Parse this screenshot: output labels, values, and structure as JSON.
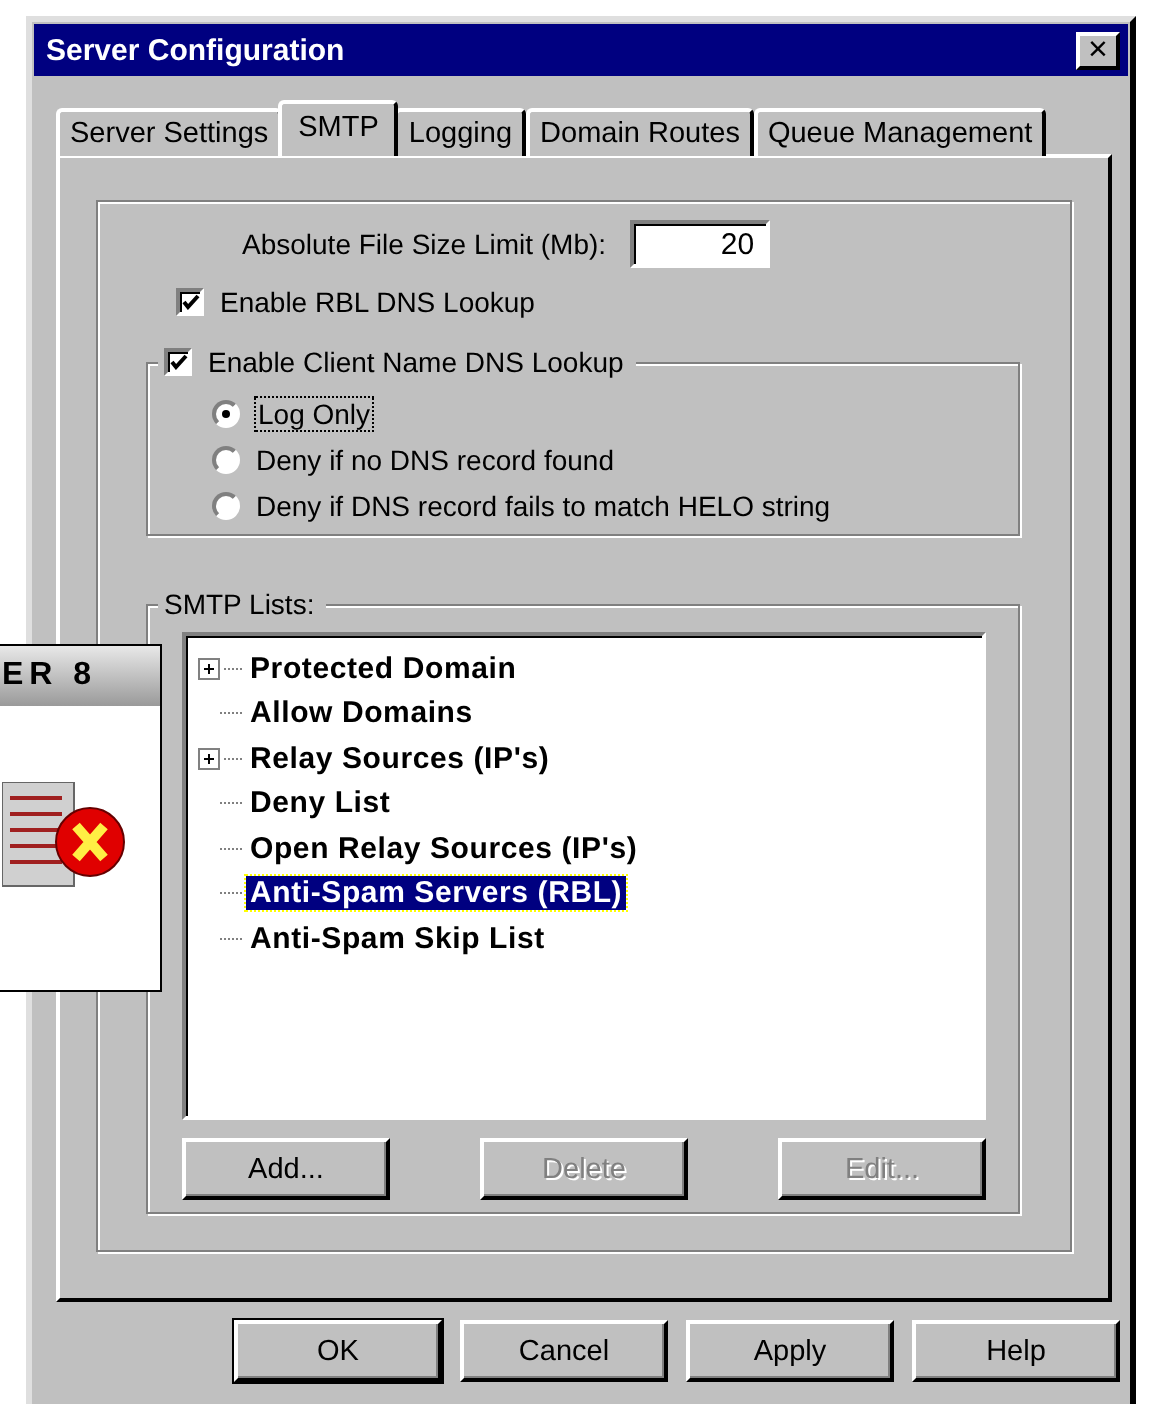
{
  "window": {
    "title": "Server Configuration",
    "close": "×"
  },
  "tabs": [
    {
      "label": "Server Settings",
      "selected": false
    },
    {
      "label": "SMTP",
      "selected": true
    },
    {
      "label": "Logging",
      "selected": false
    },
    {
      "label": "Domain Routes",
      "selected": false
    },
    {
      "label": "Queue Management",
      "selected": false
    }
  ],
  "file_size": {
    "label": "Absolute File Size Limit (Mb):",
    "value": "20"
  },
  "rbl_checkbox": {
    "label": "Enable RBL DNS Lookup",
    "checked": true
  },
  "client_name_group": {
    "label": "Enable Client Name DNS Lookup",
    "checked": true,
    "options": [
      {
        "label": "Log Only",
        "selected": true,
        "focused": true
      },
      {
        "label": "Deny if no DNS record found",
        "selected": false,
        "focused": false
      },
      {
        "label": "Deny if DNS record fails to match HELO string",
        "selected": false,
        "focused": false
      }
    ]
  },
  "smtp_lists": {
    "label": "SMTP Lists:",
    "items": [
      {
        "label": "Protected Domain",
        "expandable": true,
        "selected": false
      },
      {
        "label": "Allow Domains",
        "expandable": false,
        "selected": false
      },
      {
        "label": "Relay Sources (IP's)",
        "expandable": true,
        "selected": false
      },
      {
        "label": "Deny List",
        "expandable": false,
        "selected": false
      },
      {
        "label": "Open Relay Sources (IP's)",
        "expandable": false,
        "selected": false
      },
      {
        "label": "Anti-Spam Servers (RBL)",
        "expandable": false,
        "selected": true
      },
      {
        "label": "Anti-Spam Skip List",
        "expandable": false,
        "selected": false
      }
    ],
    "buttons": [
      {
        "label": "Add...",
        "disabled": false
      },
      {
        "label": "Delete",
        "disabled": true
      },
      {
        "label": "Edit...",
        "disabled": true
      }
    ]
  },
  "buttons": [
    {
      "label": "OK",
      "default": true
    },
    {
      "label": "Cancel",
      "default": false
    },
    {
      "label": "Apply",
      "default": false
    },
    {
      "label": "Help",
      "default": false
    }
  ],
  "background_window": {
    "title": "ER 8"
  }
}
